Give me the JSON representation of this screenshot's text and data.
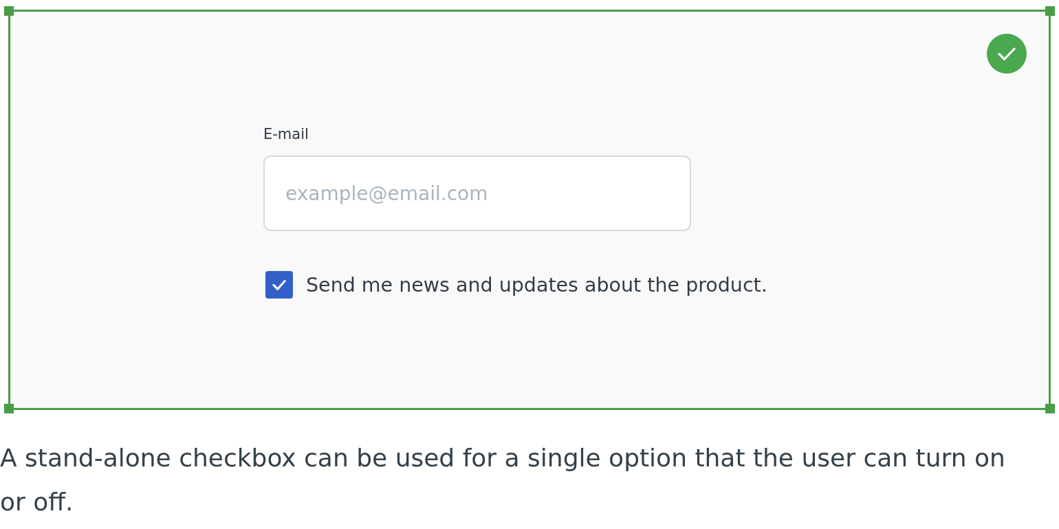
{
  "example": {
    "valid": true,
    "email": {
      "label": "E-mail",
      "placeholder": "example@email.com"
    },
    "checkbox": {
      "label": "Send me news and updates about the product.",
      "checked": true
    }
  },
  "caption": "A stand-alone checkbox can be used for a single option that the user can turn on or off."
}
